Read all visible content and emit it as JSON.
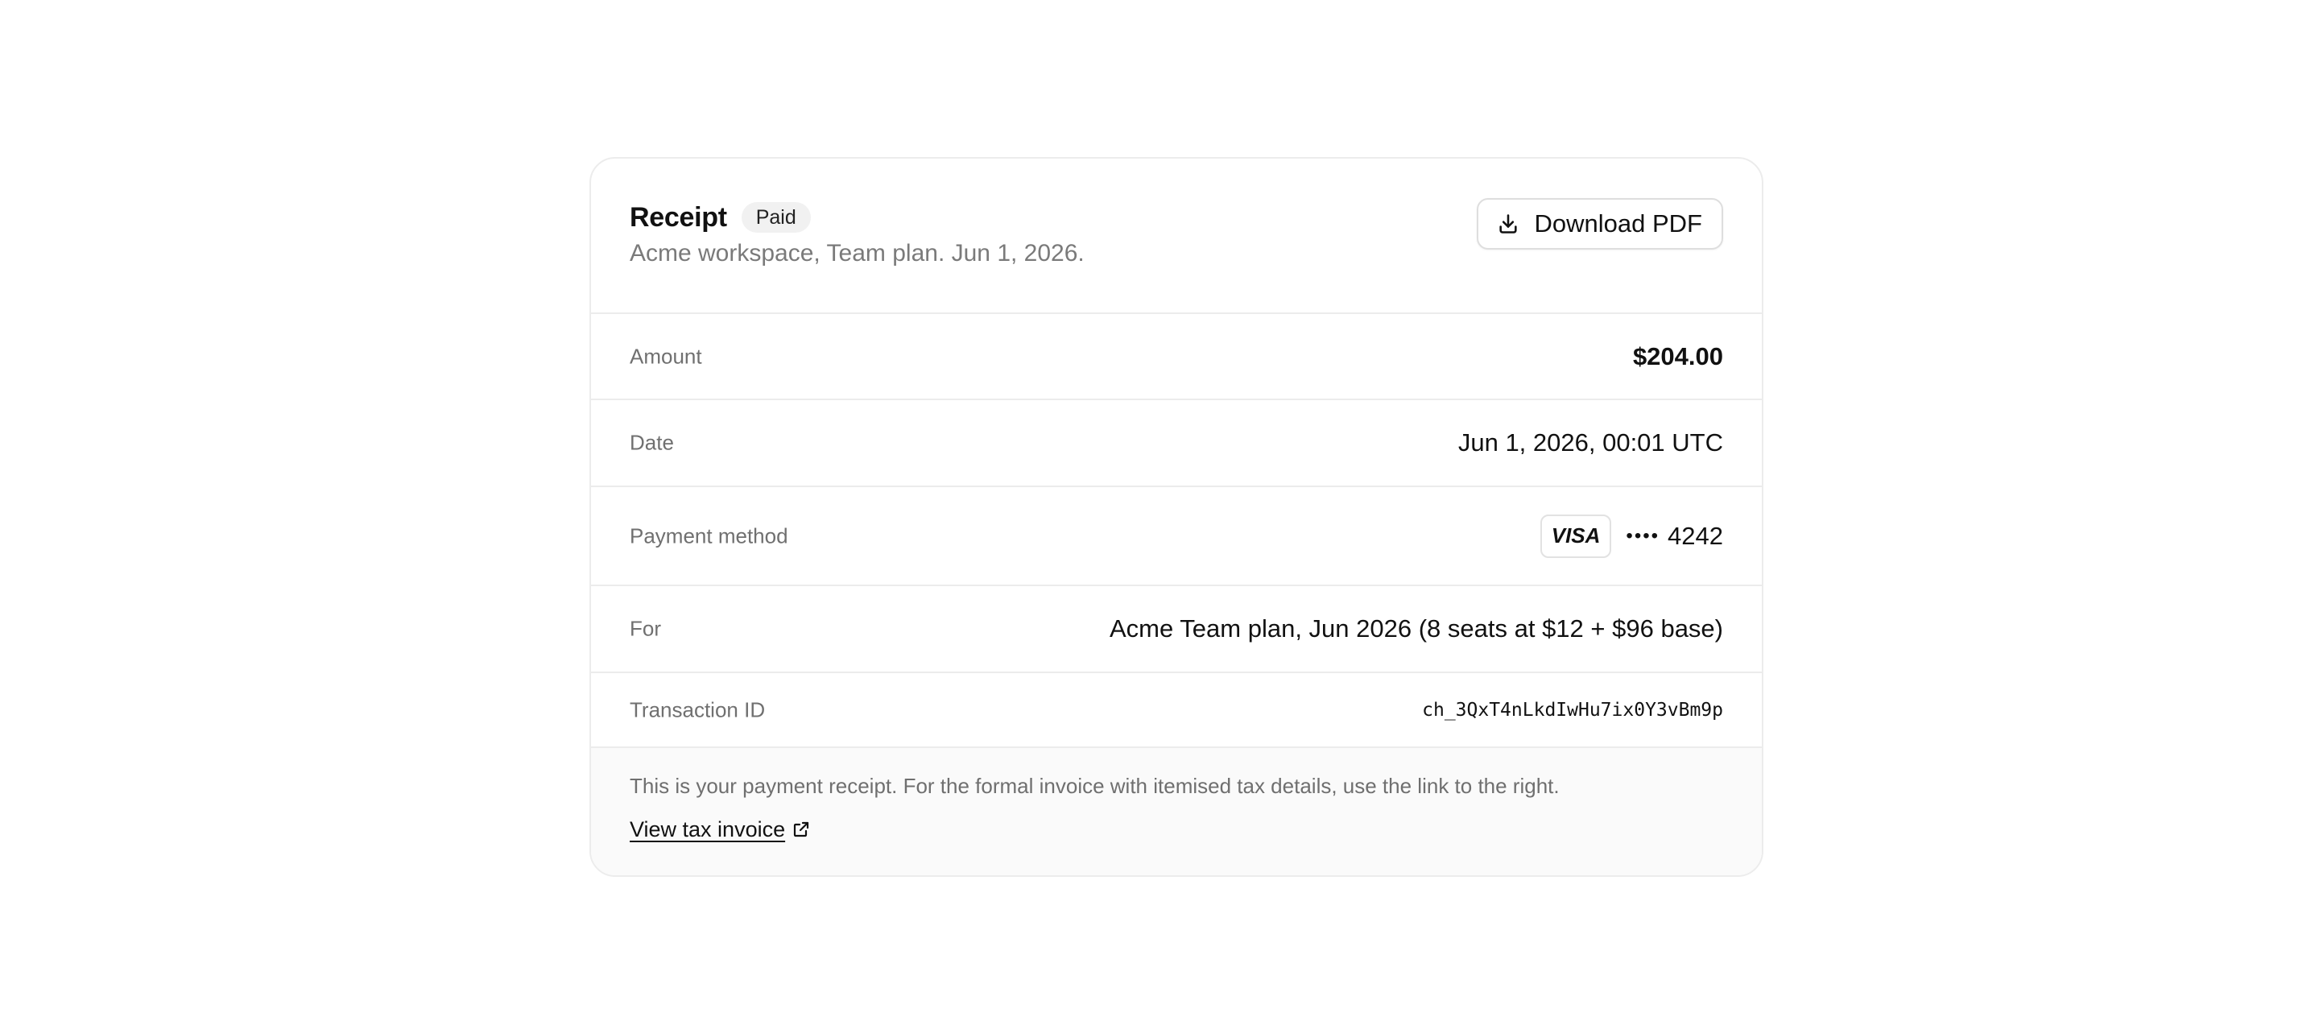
{
  "receipt": {
    "title": "Receipt",
    "status_badge": "Paid",
    "subtitle": "Acme workspace, Team plan. Jun 1, 2026.",
    "download_label": "Download PDF",
    "download_icon": "download-icon"
  },
  "details": {
    "amount": {
      "label": "Amount",
      "value": "$204.00"
    },
    "date": {
      "label": "Date",
      "value": "Jun 1, 2026, 00:01 UTC"
    },
    "payment_method": {
      "label": "Payment method",
      "brand": "VISA",
      "masked": "••••",
      "last4": "4242"
    },
    "for": {
      "label": "For",
      "value": "Acme Team plan, Jun 2026 (8 seats at $12 + $96 base)"
    },
    "transaction_id": {
      "label": "Transaction ID",
      "value": "ch_3QxT4nLkdIwHu7ix0Y3vBm9p"
    }
  },
  "footer": {
    "note": "This is your payment receipt. For the formal invoice with itemised tax details, use the link to the right.",
    "link_label": "View tax invoice",
    "link_icon": "external-link-icon"
  }
}
